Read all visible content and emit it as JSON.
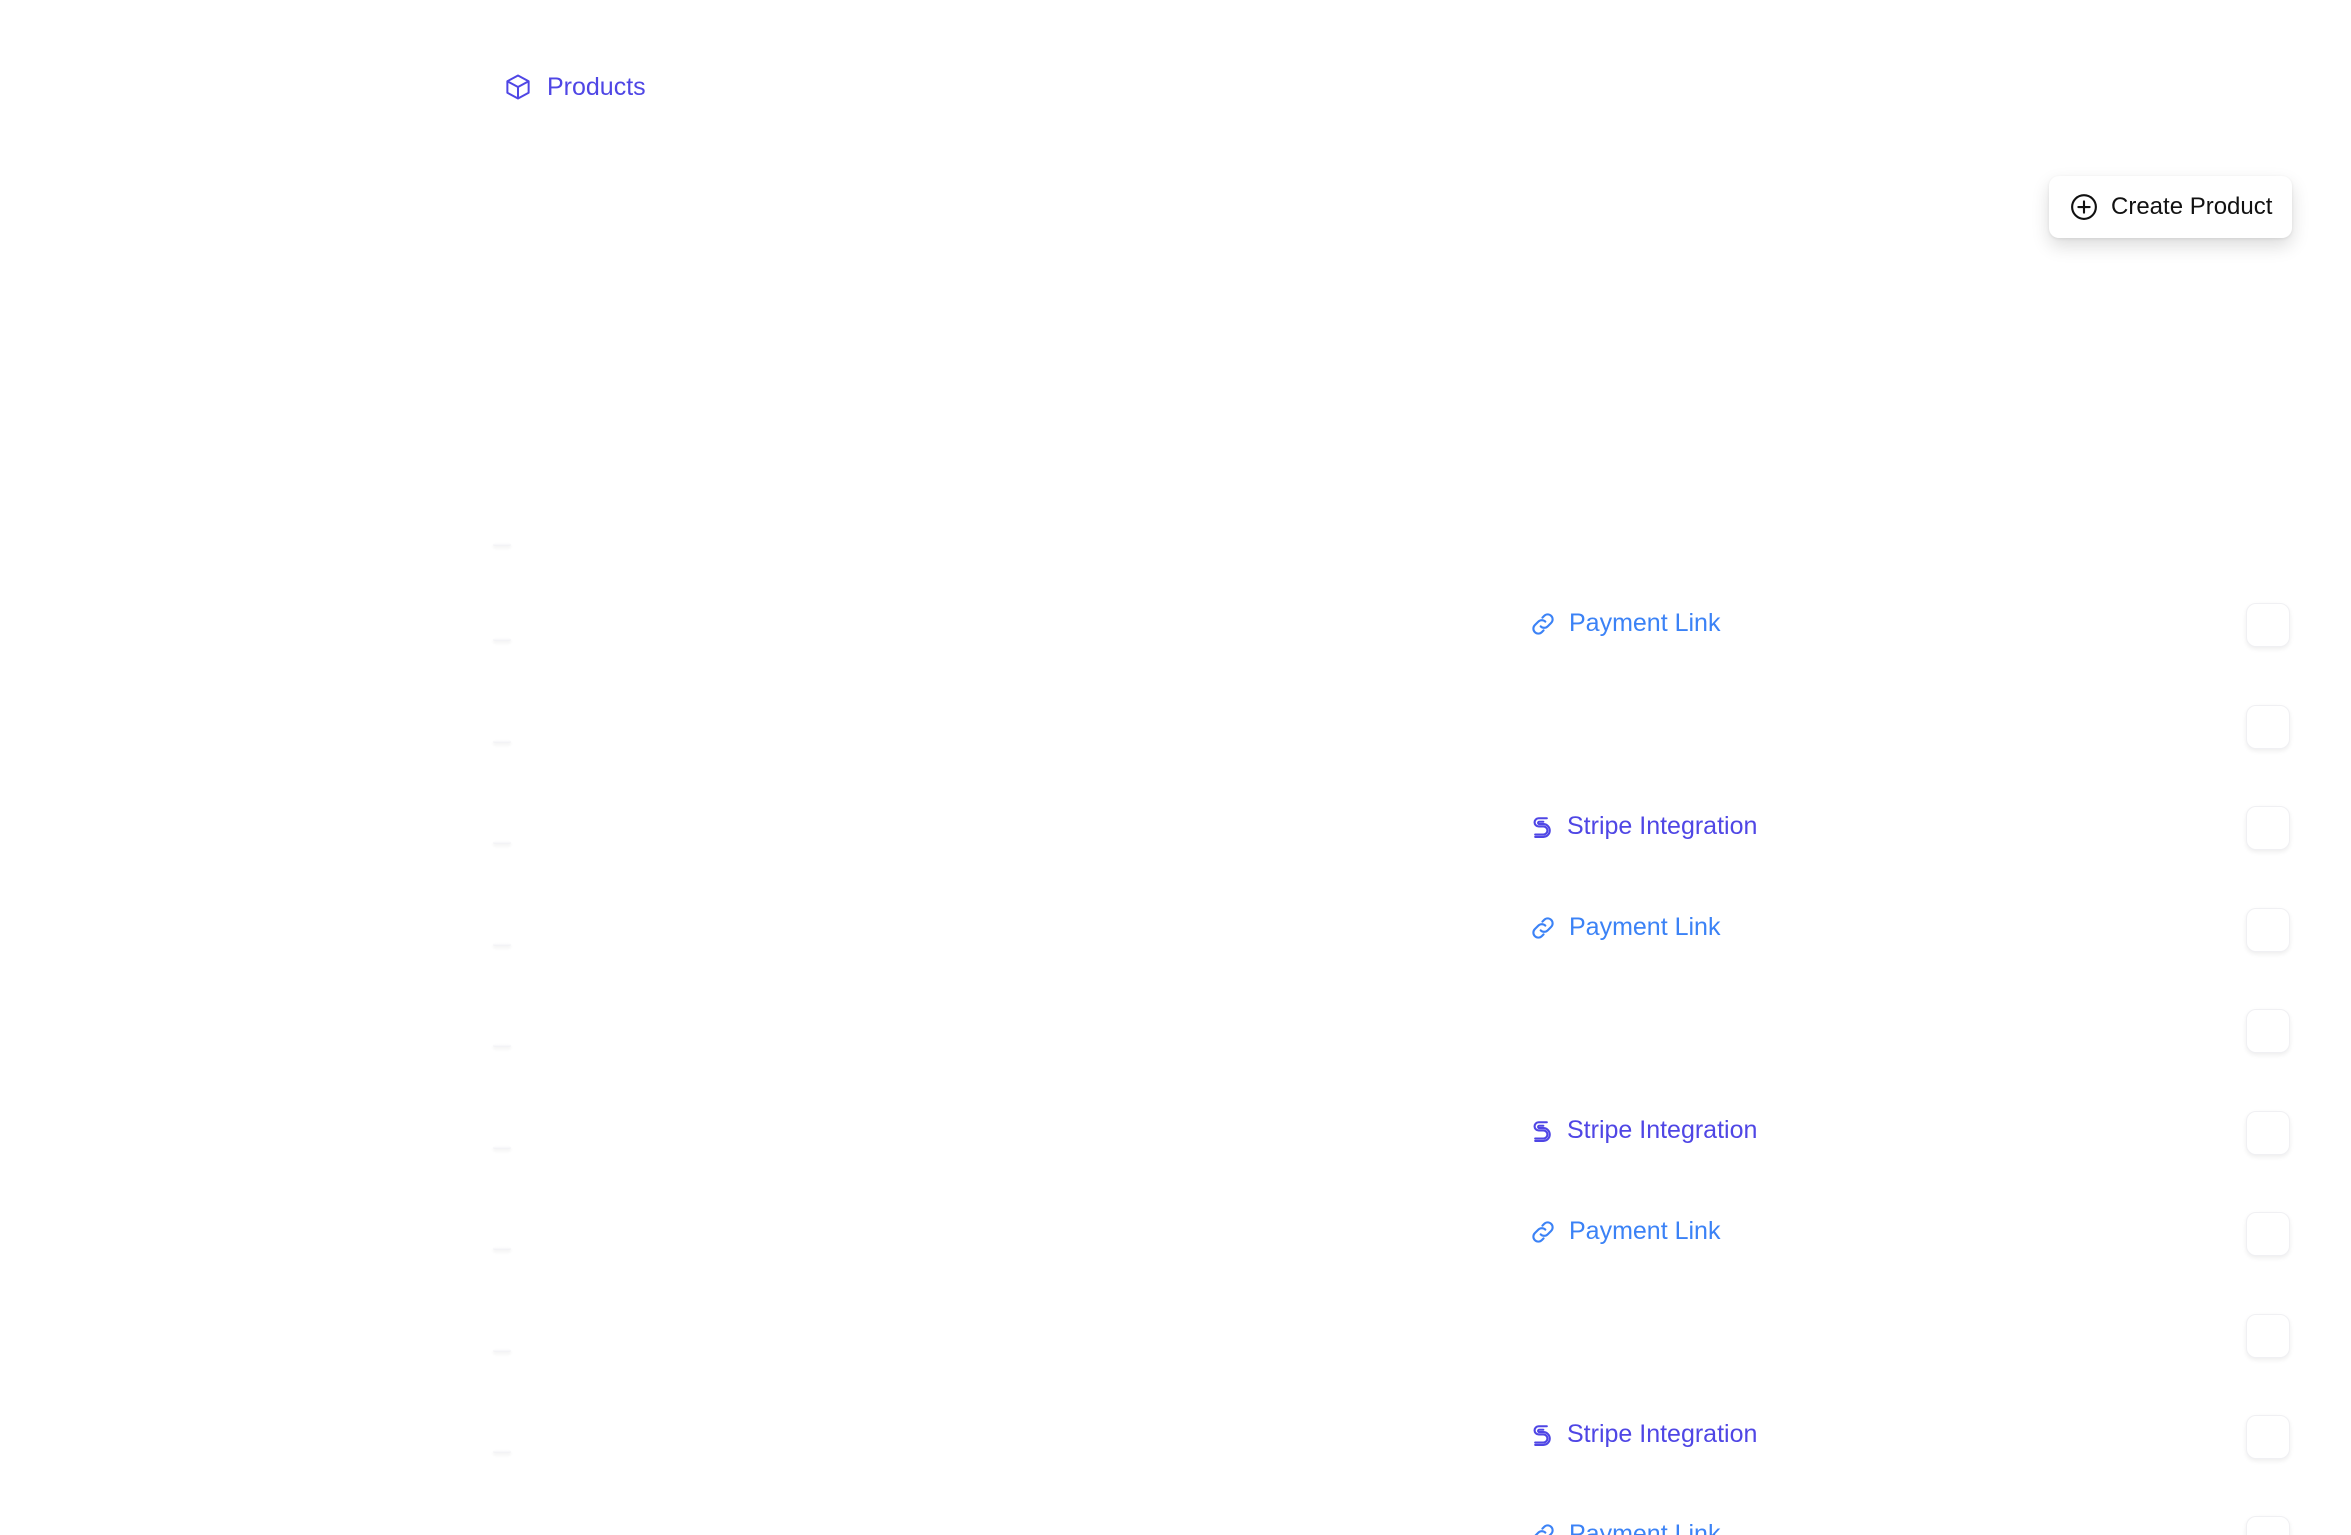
{
  "breadcrumb": {
    "label": "Products",
    "icon": "cube-icon",
    "color": "#4f46e5"
  },
  "toolbar": {
    "create_label": "Create Product",
    "create_icon": "plus-circle-icon"
  },
  "colors": {
    "payment_link": "#3b82f6",
    "stripe": "#4f46e5"
  },
  "rows": [
    {
      "integration": ""
    },
    {
      "integration": "Payment Link",
      "icon": "link-icon"
    },
    {
      "integration": ""
    },
    {
      "integration": "Stripe Integration",
      "icon": "stripe-s-icon"
    },
    {
      "integration": "Payment Link",
      "icon": "link-icon"
    },
    {
      "integration": ""
    },
    {
      "integration": "Stripe Integration",
      "icon": "stripe-s-icon"
    },
    {
      "integration": "Payment Link",
      "icon": "link-icon"
    },
    {
      "integration": ""
    },
    {
      "integration": "Stripe Integration",
      "icon": "stripe-s-icon"
    },
    {
      "integration": "Payment Link",
      "icon": "link-icon"
    }
  ]
}
